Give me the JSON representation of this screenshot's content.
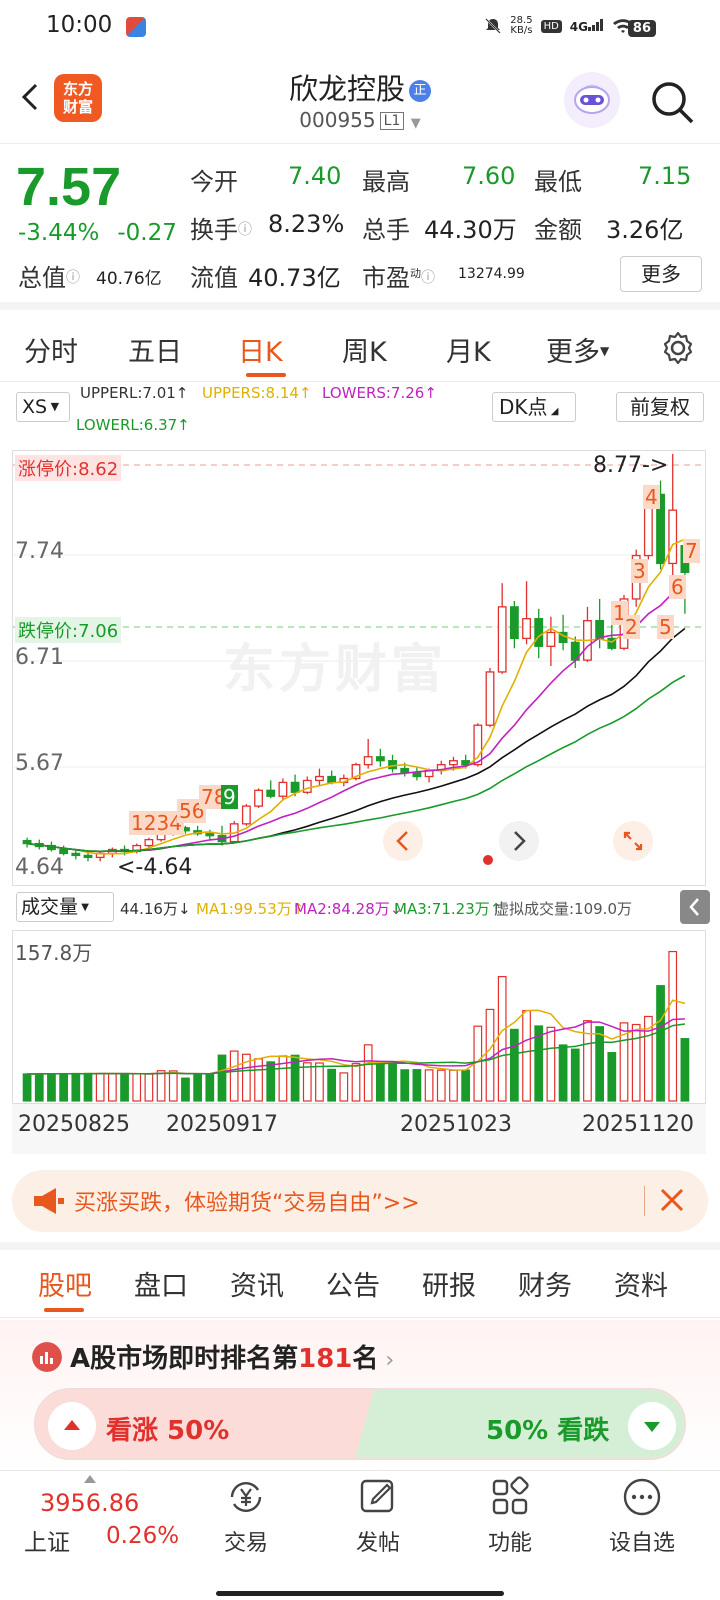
{
  "status": {
    "time": "10:00",
    "net_speed_value": "28.5",
    "net_speed_unit": "KB/s",
    "hd": "HD",
    "signal": "4G",
    "battery": "86"
  },
  "header": {
    "logo_line1": "东方",
    "logo_line2": "财富",
    "stock_name": "欣龙控股",
    "badge": "正",
    "stock_code": "000955",
    "level": "L1"
  },
  "quote": {
    "price": "7.57",
    "change_pct": "-3.44%",
    "change_abs": "-0.27",
    "open_label": "今开",
    "open": "7.40",
    "high_label": "最高",
    "high": "7.60",
    "low_label": "最低",
    "low": "7.15",
    "turnover_label": "换手",
    "turnover": "8.23%",
    "volume_label": "总手",
    "volume": "44.30万",
    "amount_label": "金额",
    "amount": "3.26亿",
    "mcap_label": "总值",
    "mcap": "40.76亿",
    "float_label": "流值",
    "float": "40.73亿",
    "pe_label": "市盈",
    "pe_sup": "动",
    "pe": "13274.99",
    "more_btn": "更多"
  },
  "period_tabs": [
    "分时",
    "五日",
    "日K",
    "周K",
    "月K",
    "更多"
  ],
  "indicators": {
    "selector": "XS",
    "upperl": "UPPERL:7.01↑",
    "uppers": "UPPERS:8.14↑",
    "lowers": "LOWERS:7.26↑",
    "lowerl": "LOWERL:6.37↑",
    "dk_btn": "DK点",
    "adjust_btn": "前复权"
  },
  "chart_data": {
    "type": "candlestick",
    "price_labels": [
      "7.74",
      "6.71",
      "5.67",
      "4.64"
    ],
    "limit_up_label": "涨停价:8.62",
    "limit_down_label": "跌停价:7.06",
    "high_marker": "8.77->",
    "low_marker": "<-4.64",
    "watermark": "东方财富",
    "signal_marks": [
      "1",
      "2",
      "3",
      "4",
      "5",
      "6",
      "7",
      "8",
      "9"
    ],
    "signal_marks_right": [
      "4",
      "7",
      "3",
      "6",
      "1",
      "2",
      "5"
    ],
    "ohlc": [
      [
        4.85,
        4.88,
        4.78,
        4.82
      ],
      [
        4.82,
        4.86,
        4.76,
        4.79
      ],
      [
        4.8,
        4.84,
        4.74,
        4.76
      ],
      [
        4.76,
        4.8,
        4.7,
        4.72
      ],
      [
        4.72,
        4.76,
        4.66,
        4.7
      ],
      [
        4.7,
        4.74,
        4.64,
        4.68
      ],
      [
        4.68,
        4.74,
        4.64,
        4.72
      ],
      [
        4.72,
        4.78,
        4.68,
        4.76
      ],
      [
        4.76,
        4.8,
        4.7,
        4.74
      ],
      [
        4.74,
        4.82,
        4.72,
        4.8
      ],
      [
        4.8,
        4.88,
        4.78,
        4.86
      ],
      [
        4.86,
        4.96,
        4.84,
        4.94
      ],
      [
        4.94,
        5.02,
        4.9,
        4.98
      ],
      [
        4.98,
        5.0,
        4.92,
        4.95
      ],
      [
        4.95,
        5.0,
        4.9,
        4.92
      ],
      [
        4.92,
        4.96,
        4.86,
        4.9
      ],
      [
        4.9,
        5.0,
        4.8,
        4.84
      ],
      [
        4.84,
        5.05,
        4.82,
        5.02
      ],
      [
        5.02,
        5.22,
        5.0,
        5.2
      ],
      [
        5.2,
        5.38,
        5.18,
        5.36
      ],
      [
        5.36,
        5.46,
        5.28,
        5.3
      ],
      [
        5.3,
        5.48,
        5.26,
        5.44
      ],
      [
        5.44,
        5.52,
        5.3,
        5.34
      ],
      [
        5.34,
        5.5,
        5.32,
        5.46
      ],
      [
        5.46,
        5.58,
        5.4,
        5.5
      ],
      [
        5.5,
        5.56,
        5.42,
        5.44
      ],
      [
        5.44,
        5.52,
        5.4,
        5.48
      ],
      [
        5.48,
        5.64,
        5.46,
        5.62
      ],
      [
        5.62,
        5.88,
        5.58,
        5.7
      ],
      [
        5.7,
        5.78,
        5.6,
        5.66
      ],
      [
        5.66,
        5.72,
        5.54,
        5.58
      ],
      [
        5.58,
        5.64,
        5.5,
        5.54
      ],
      [
        5.54,
        5.6,
        5.46,
        5.5
      ],
      [
        5.5,
        5.58,
        5.44,
        5.56
      ],
      [
        5.56,
        5.66,
        5.52,
        5.62
      ],
      [
        5.62,
        5.7,
        5.56,
        5.66
      ],
      [
        5.66,
        5.72,
        5.58,
        5.62
      ],
      [
        5.62,
        6.04,
        5.6,
        6.02
      ],
      [
        6.02,
        6.6,
        6.0,
        6.56
      ],
      [
        6.56,
        7.46,
        6.54,
        7.22
      ],
      [
        7.22,
        7.28,
        6.8,
        6.9
      ],
      [
        6.9,
        7.48,
        6.84,
        7.1
      ],
      [
        7.1,
        7.2,
        6.7,
        6.82
      ],
      [
        6.82,
        7.12,
        6.62,
        6.96
      ],
      [
        6.96,
        7.14,
        6.78,
        6.86
      ],
      [
        6.86,
        6.92,
        6.6,
        6.68
      ],
      [
        6.68,
        7.22,
        6.66,
        7.08
      ],
      [
        7.08,
        7.3,
        6.8,
        6.9
      ],
      [
        6.9,
        7.08,
        6.78,
        6.8
      ],
      [
        6.8,
        7.34,
        6.78,
        7.3
      ],
      [
        7.3,
        7.8,
        7.22,
        7.74
      ],
      [
        7.74,
        8.4,
        7.7,
        8.36
      ],
      [
        8.36,
        8.5,
        7.6,
        7.66
      ],
      [
        7.66,
        8.77,
        7.5,
        8.2
      ],
      [
        7.84,
        7.6,
        7.15,
        7.57
      ]
    ],
    "volume_label": "成交量",
    "volume_value": "44.16万↓",
    "ma1_label": "MA1:99.53万↑",
    "ma2_label": "MA2:84.28万↓",
    "ma3_label": "MA3:71.23万↑",
    "virtual_volume": "虚拟成交量:109.0万",
    "volume_max_label": "157.8万",
    "dates": [
      "20250825",
      "20250917",
      "20251023",
      "20251120"
    ],
    "volume_range": [
      0,
      157.8
    ],
    "price_range": [
      4.4,
      8.8
    ]
  },
  "banner": {
    "text": "买涨买跌，体验期货“交易自由”>>"
  },
  "bottom_tabs": [
    "股吧",
    "盘口",
    "资讯",
    "公告",
    "研报",
    "财务",
    "资料"
  ],
  "ranking": {
    "prefix": "A股市场即时排名第",
    "rank": "181",
    "suffix": "名",
    "bull_label": "看涨 50%",
    "bear_label": "50% 看跌"
  },
  "nav": {
    "index_value": "3956.86",
    "index_name": "上证",
    "index_pct": "0.26%",
    "items": [
      "交易",
      "发帖",
      "功能",
      "设自选"
    ]
  },
  "colors": {
    "up": "#e0312c",
    "down": "#1a9a2a",
    "accent": "#e8581e"
  }
}
